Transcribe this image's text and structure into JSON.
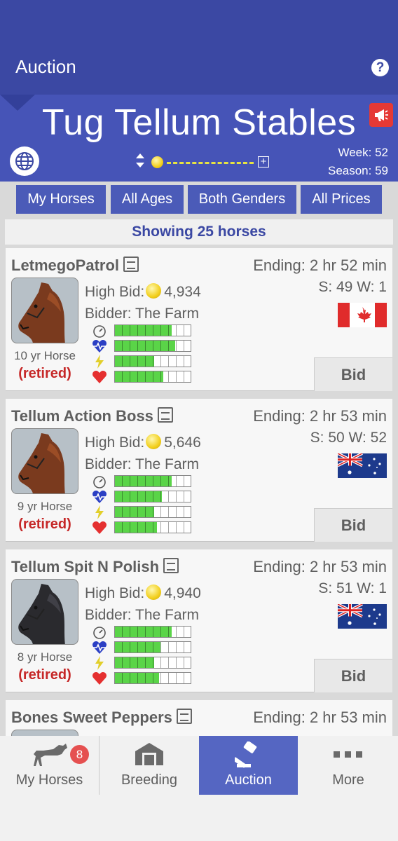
{
  "appbar": {
    "title": "Auction"
  },
  "stable": {
    "name": "Tug Tellum Stables",
    "week": "Week: 52",
    "season": "Season: 59"
  },
  "filters": [
    {
      "label": "My Horses"
    },
    {
      "label": "All Ages"
    },
    {
      "label": "Both Genders"
    },
    {
      "label": "All Prices"
    }
  ],
  "showing": "Showing 25 horses",
  "horses": [
    {
      "name": "LetmegoPatrol",
      "ending": "Ending: 2 hr 52 min",
      "sw": "S: 49 W: 1",
      "high_bid_label": "High Bid:",
      "high_bid": "4,934",
      "bidder": "Bidder: The Farm",
      "age": "10 yr Horse",
      "status": "(retired)",
      "country": "Canada",
      "coat": "bay",
      "stats": {
        "speed": 0.75,
        "stamina": 0.8,
        "energy": 0.52,
        "health": 0.64
      },
      "bid_label": "Bid"
    },
    {
      "name": "Tellum Action Boss",
      "ending": "Ending: 2 hr 53 min",
      "sw": "S: 50 W: 52",
      "high_bid_label": "High Bid:",
      "high_bid": "5,646",
      "bidder": "Bidder: The Farm",
      "age": "9 yr Horse",
      "status": "(retired)",
      "country": "Australia",
      "coat": "bay",
      "stats": {
        "speed": 0.75,
        "stamina": 0.62,
        "energy": 0.52,
        "health": 0.56
      },
      "bid_label": "Bid"
    },
    {
      "name": "Tellum Spit N Polish",
      "ending": "Ending: 2 hr 53 min",
      "sw": "S: 51 W: 1",
      "high_bid_label": "High Bid:",
      "high_bid": "4,940",
      "bidder": "Bidder: The Farm",
      "age": "8 yr Horse",
      "status": "(retired)",
      "country": "Australia",
      "coat": "black",
      "stats": {
        "speed": 0.75,
        "stamina": 0.6,
        "energy": 0.52,
        "health": 0.58
      },
      "bid_label": "Bid"
    },
    {
      "name": "Bones Sweet Peppers",
      "ending": "Ending: 2 hr 53 min"
    }
  ],
  "nav": [
    {
      "label": "My Horses",
      "icon": "horse-icon",
      "badge": "8"
    },
    {
      "label": "Breeding",
      "icon": "barn-icon"
    },
    {
      "label": "Auction",
      "icon": "gavel-icon",
      "active": true
    },
    {
      "label": "More",
      "icon": "more-dots-icon"
    }
  ],
  "colors": {
    "primary": "#3b48a3",
    "header": "#4654b7",
    "bar_fill": "#5ad448",
    "retired": "#c62828",
    "badge": "#e55050"
  }
}
